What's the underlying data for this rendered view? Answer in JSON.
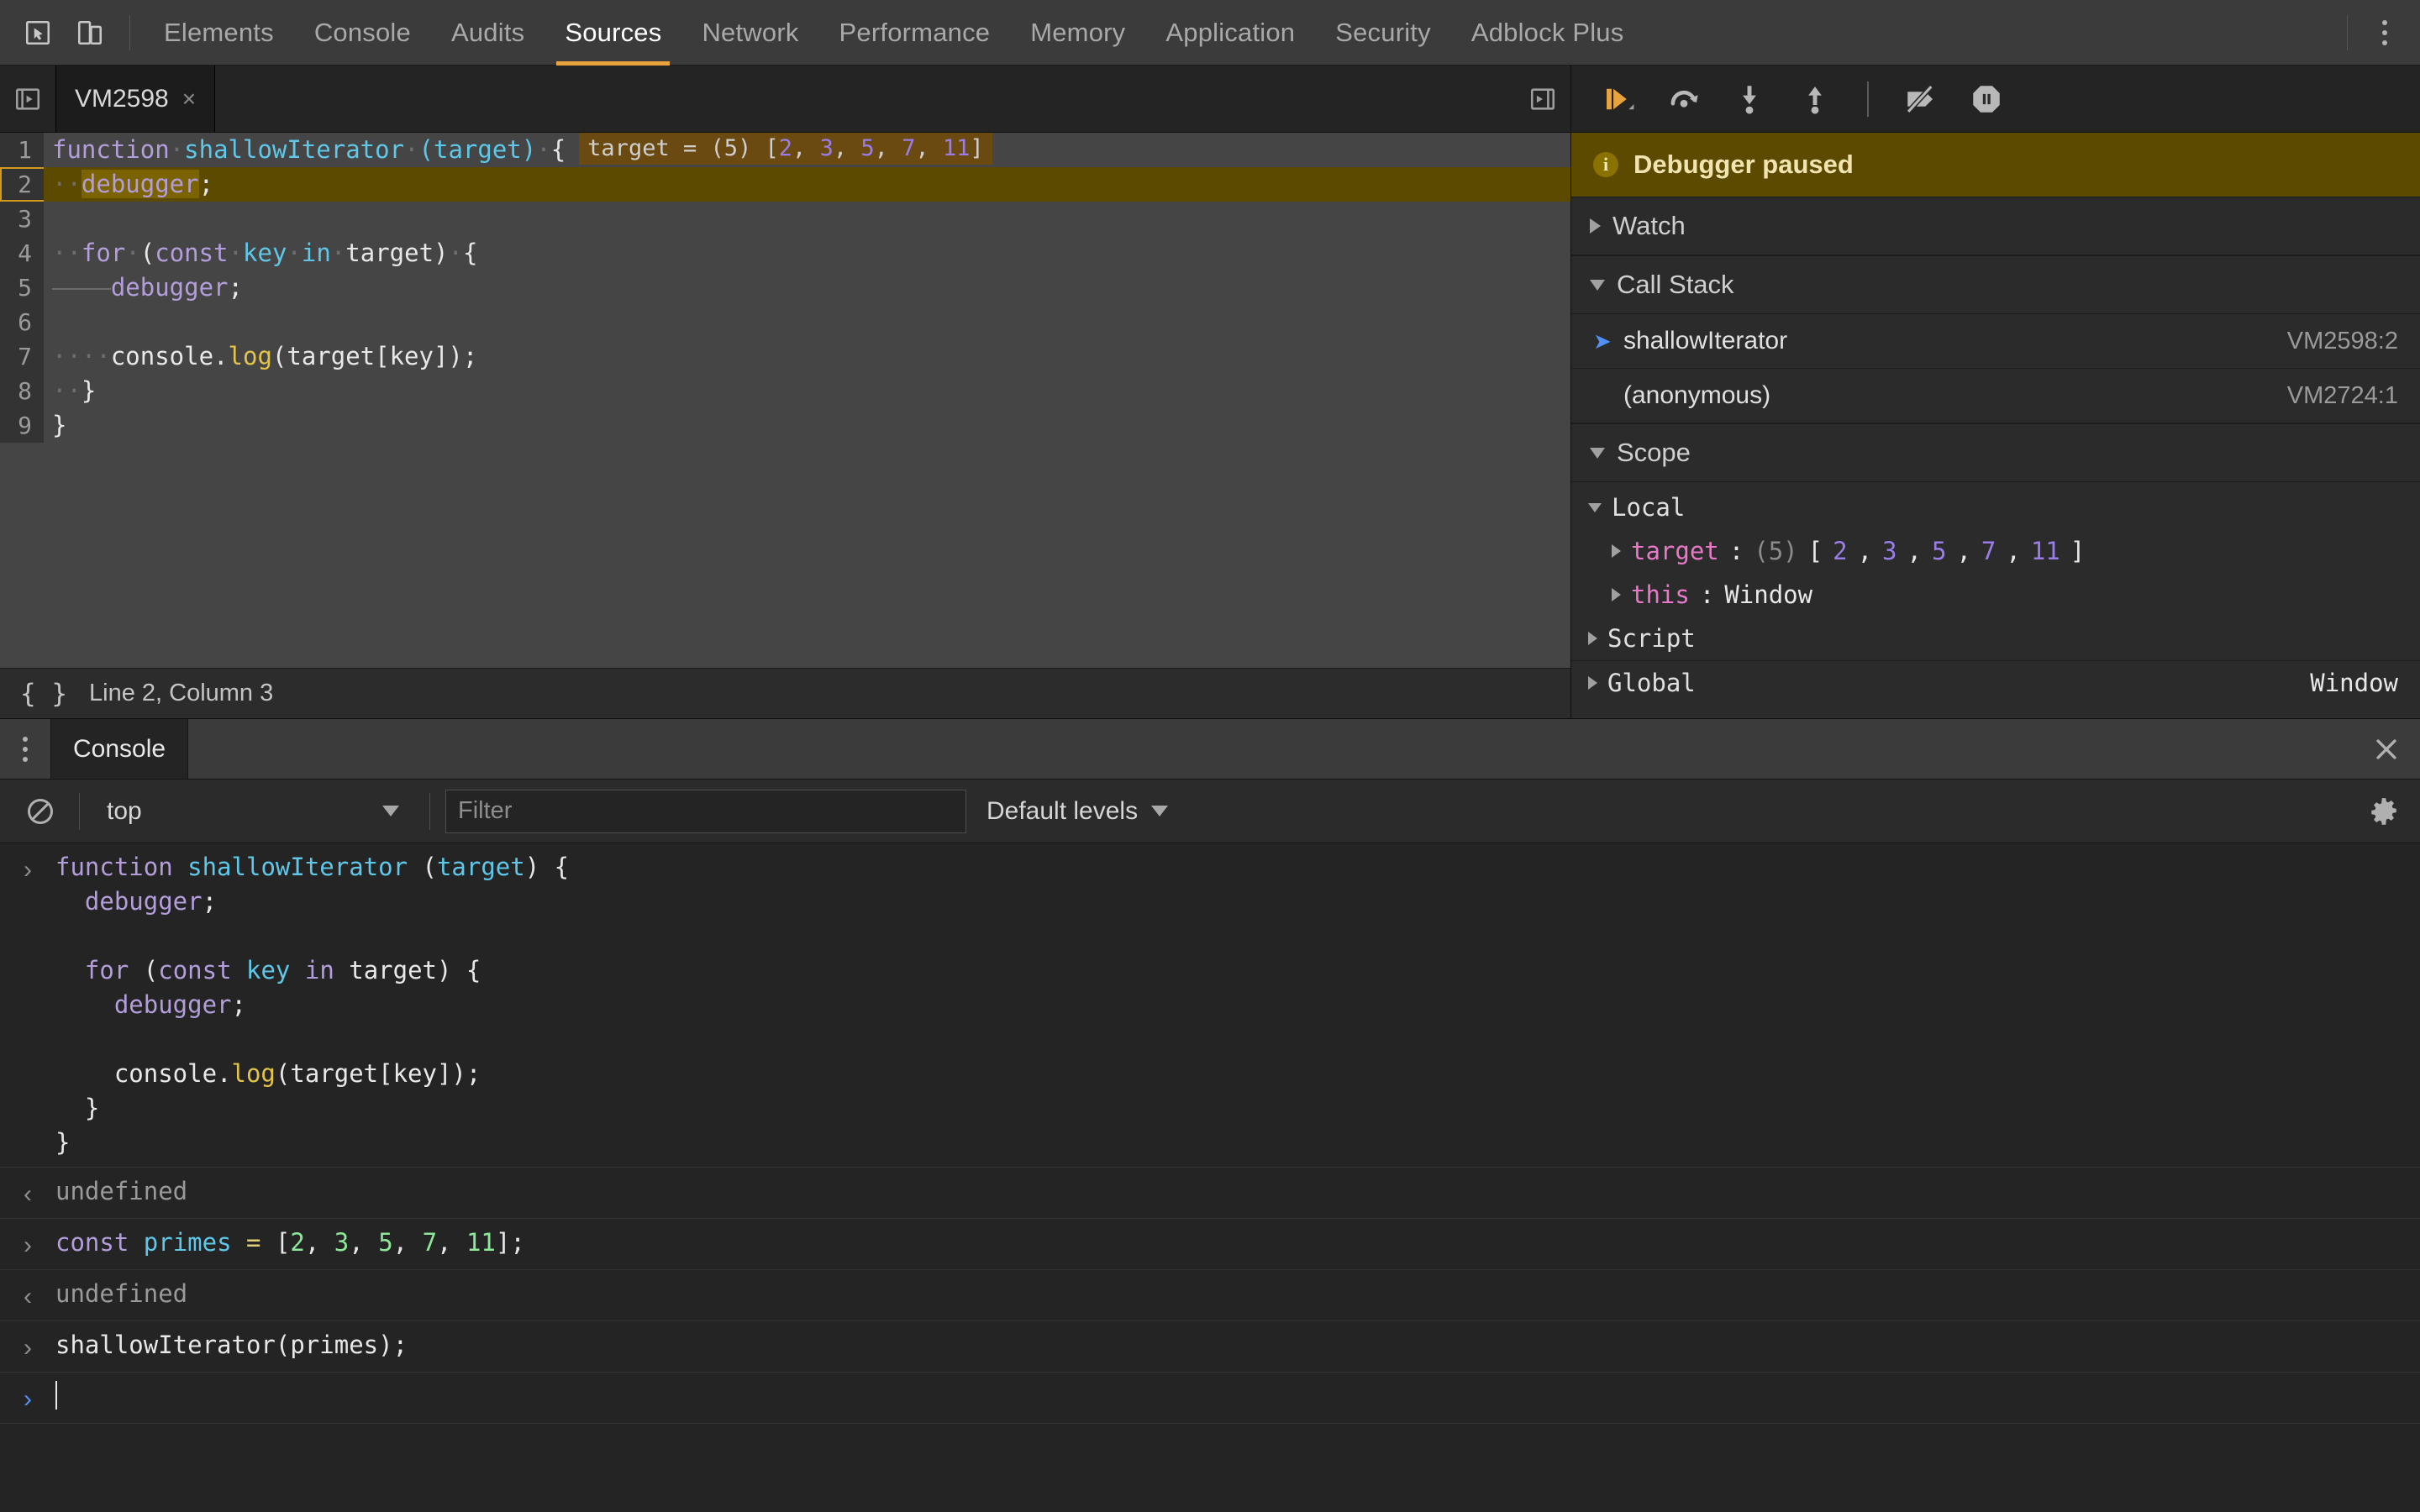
{
  "toolbar": {
    "inspect_icon": "inspect-element-icon",
    "device_icon": "device-toolbar-icon",
    "tabs": [
      {
        "label": "Elements",
        "active": false
      },
      {
        "label": "Console",
        "active": false
      },
      {
        "label": "Audits",
        "active": false
      },
      {
        "label": "Sources",
        "active": true
      },
      {
        "label": "Network",
        "active": false
      },
      {
        "label": "Performance",
        "active": false
      },
      {
        "label": "Memory",
        "active": false
      },
      {
        "label": "Application",
        "active": false
      },
      {
        "label": "Security",
        "active": false
      },
      {
        "label": "Adblock Plus",
        "active": false
      }
    ],
    "more_icon": "kebab-menu-icon",
    "accent_color": "#e8a33d"
  },
  "sources": {
    "nav_toggle_icon": "show-navigator-icon",
    "file_tab": {
      "label": "VM2598",
      "close_label": "×"
    },
    "debugger_pane_toggle_icon": "show-debugger-icon",
    "status": {
      "braces_icon": "pretty-print-icon",
      "position": "Line 2, Column 3"
    },
    "code_lines": [
      {
        "n": "1",
        "paused": false
      },
      {
        "n": "2",
        "paused": true
      },
      {
        "n": "3",
        "paused": false
      },
      {
        "n": "4",
        "paused": false
      },
      {
        "n": "5",
        "paused": false
      },
      {
        "n": "6",
        "paused": false
      },
      {
        "n": "7",
        "paused": false
      },
      {
        "n": "8",
        "paused": false
      },
      {
        "n": "9",
        "paused": false
      }
    ],
    "code_text": {
      "l1_kw": "function",
      "l1_name": "shallowIterator",
      "l1_paren_open": "(",
      "l1_param": "target",
      "l1_paren_close": ")",
      "l1_brace": "{",
      "l2_indent": "··",
      "l2_kw": "debugger",
      "l2_semi": ";",
      "l4_indent": "··",
      "l4_for": "for",
      "l4_paren": "(",
      "l4_const": "const",
      "l4_key": "key",
      "l4_in": "in",
      "l4_target": "target",
      "l4_close": ")",
      "l4_brace": "{",
      "l5_indent": "————",
      "l5_kw": "debugger",
      "l5_semi": ";",
      "l7_indent": "····",
      "l7_console": "console.",
      "l7_log": "log",
      "l7_rest": "(target[key]);",
      "l8_indent": "··",
      "l8_brace": "}",
      "l9_brace": "}"
    },
    "inline_value": {
      "name": "target = ",
      "count": "(5) ",
      "open": "[",
      "items": [
        "2",
        "3",
        "5",
        "7",
        "11"
      ],
      "close": "]"
    }
  },
  "debugger": {
    "controls": [
      {
        "name": "resume-script-execution",
        "icon": "resume-icon"
      },
      {
        "name": "step-over-next-function-call",
        "icon": "step-over-icon"
      },
      {
        "name": "step-into-next-function-call",
        "icon": "step-into-icon"
      },
      {
        "name": "step-out-of-current-function",
        "icon": "step-out-icon"
      },
      {
        "name": "deactivate-breakpoints",
        "icon": "deactivate-breakpoints-icon"
      },
      {
        "name": "pause-on-exceptions",
        "icon": "pause-on-exceptions-icon"
      }
    ],
    "paused_banner": {
      "icon": "info-icon",
      "text": "Debugger paused"
    },
    "watch": {
      "label": "Watch",
      "expanded": false
    },
    "call_stack": {
      "label": "Call Stack",
      "expanded": true,
      "frames": [
        {
          "name": "shallowIterator",
          "location": "VM2598:2",
          "selected": true
        },
        {
          "name": "(anonymous)",
          "location": "VM2724:1",
          "selected": false
        }
      ]
    },
    "scope": {
      "label": "Scope",
      "expanded": true,
      "groups": [
        {
          "label": "Local",
          "expanded": true,
          "props": [
            {
              "name": "target",
              "sep": ": ",
              "count": "(5) ",
              "open": "[",
              "items": [
                "2",
                "3",
                "5",
                "7",
                "11"
              ],
              "close": "]",
              "kind": "array"
            },
            {
              "name": "this",
              "sep": ": ",
              "value": "Window",
              "kind": "object"
            }
          ]
        },
        {
          "label": "Script",
          "expanded": false,
          "props": []
        },
        {
          "label": "Global",
          "expanded": false,
          "value": "Window",
          "props": []
        }
      ]
    }
  },
  "drawer": {
    "kebab_icon": "drawer-more-icon",
    "tabs": [
      {
        "label": "Console",
        "active": true
      }
    ],
    "close_icon": "close-drawer-icon",
    "console_toolbar": {
      "clear_icon": "clear-console-icon",
      "context": "top",
      "filter_placeholder": "Filter",
      "filter_value": "",
      "levels": "Default levels",
      "settings_icon": "settings-gear-icon"
    },
    "entries": [
      {
        "type": "input",
        "lines": [
          [
            {
              "t": "function ",
              "c": "c-kw"
            },
            {
              "t": "shallowIterator ",
              "c": "c-fn"
            },
            {
              "t": "(",
              "c": ""
            },
            {
              "t": "target",
              "c": "c-fn"
            },
            {
              "t": ") {",
              "c": ""
            }
          ],
          [
            {
              "t": "  ",
              "c": ""
            },
            {
              "t": "debugger",
              "c": "c-kw"
            },
            {
              "t": ";",
              "c": ""
            }
          ],
          [
            {
              "t": "",
              "c": ""
            }
          ],
          [
            {
              "t": "  ",
              "c": ""
            },
            {
              "t": "for",
              "c": "c-kw"
            },
            {
              "t": " (",
              "c": ""
            },
            {
              "t": "const",
              "c": "c-kw"
            },
            {
              "t": " ",
              "c": ""
            },
            {
              "t": "key",
              "c": "c-fn"
            },
            {
              "t": " ",
              "c": ""
            },
            {
              "t": "in",
              "c": "c-kw"
            },
            {
              "t": " target) {",
              "c": ""
            }
          ],
          [
            {
              "t": "    ",
              "c": ""
            },
            {
              "t": "debugger",
              "c": "c-kw"
            },
            {
              "t": ";",
              "c": ""
            }
          ],
          [
            {
              "t": "",
              "c": ""
            }
          ],
          [
            {
              "t": "    console.",
              "c": ""
            },
            {
              "t": "log",
              "c": "c-prop"
            },
            {
              "t": "(target[key]);",
              "c": ""
            }
          ],
          [
            {
              "t": "  }",
              "c": ""
            }
          ],
          [
            {
              "t": "}",
              "c": ""
            }
          ]
        ]
      },
      {
        "type": "result",
        "lines": [
          [
            {
              "t": "undefined",
              "c": "undef"
            }
          ]
        ]
      },
      {
        "type": "input",
        "lines": [
          [
            {
              "t": "const",
              "c": "c-kw"
            },
            {
              "t": " ",
              "c": ""
            },
            {
              "t": "primes",
              "c": "c-var"
            },
            {
              "t": " ",
              "c": ""
            },
            {
              "t": "=",
              "c": "c-op"
            },
            {
              "t": " [",
              "c": ""
            },
            {
              "t": "2",
              "c": "c-num-green"
            },
            {
              "t": ", ",
              "c": ""
            },
            {
              "t": "3",
              "c": "c-num-green"
            },
            {
              "t": ", ",
              "c": ""
            },
            {
              "t": "5",
              "c": "c-num-green"
            },
            {
              "t": ", ",
              "c": ""
            },
            {
              "t": "7",
              "c": "c-num-green"
            },
            {
              "t": ", ",
              "c": ""
            },
            {
              "t": "11",
              "c": "c-num-green"
            },
            {
              "t": "];",
              "c": ""
            }
          ]
        ]
      },
      {
        "type": "result",
        "lines": [
          [
            {
              "t": "undefined",
              "c": "undef"
            }
          ]
        ]
      },
      {
        "type": "input",
        "lines": [
          [
            {
              "t": "shallowIterator(primes);",
              "c": ""
            }
          ]
        ]
      },
      {
        "type": "prompt",
        "lines": [
          [
            {
              "t": "",
              "c": ""
            }
          ]
        ]
      }
    ]
  }
}
